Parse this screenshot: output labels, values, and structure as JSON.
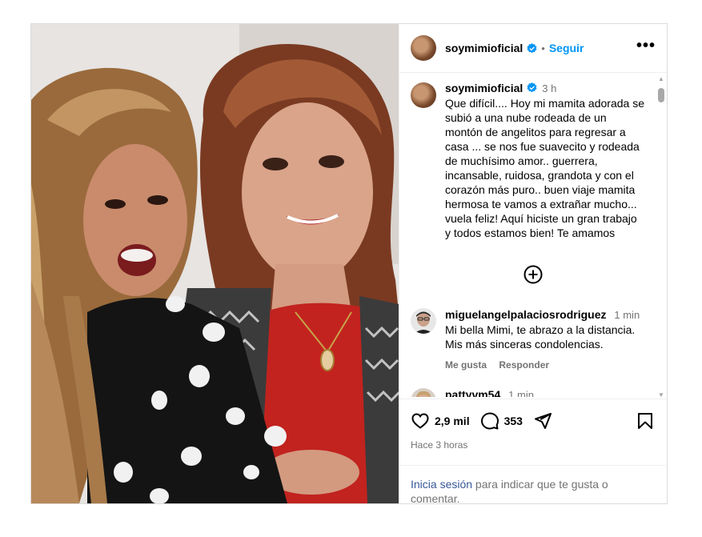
{
  "post": {
    "username": "soymimioficial",
    "follow_label": "Seguir",
    "separator": "•",
    "more_label": "•••",
    "caption_time": "3 h",
    "caption_text": "Que difícil.... Hoy mi mamita adorada se subió a una nube rodeada de un montón de angelitos para regresar a casa ... se nos fue suavecito y rodeada de muchísimo amor.. guerrera, incansable, ruidosa, grandota y con el corazón más puro.. buen viaje mamita hermosa te vamos a extrañar mucho... vuela feliz! Aquí hiciste un gran trabajo y todos estamos bien! Te amamos"
  },
  "comments": [
    {
      "username": "miguelangelpalaciosrodriguez",
      "time": "1 min",
      "text": "Mi bella Mimi, te abrazo a la distancia. Mis más sinceras condolencias.",
      "like_label": "Me gusta",
      "reply_label": "Responder"
    },
    {
      "username": "pattyvm54",
      "time": "1 min"
    }
  ],
  "footer": {
    "likes": "2,9 mil",
    "comments_count": "353",
    "posted_ago": "Hace 3 horas",
    "login_link": "Inicia sesión",
    "login_rest": " para indicar que te gusta o comentar."
  },
  "icons": {
    "header_avatar": "avatar-photo",
    "verified": "verified-badge-icon",
    "add_comment": "plus-circle-icon",
    "like": "heart-icon",
    "comment": "speech-bubble-icon",
    "share": "paper-plane-icon",
    "save": "bookmark-icon"
  },
  "colors": {
    "link_blue": "#0095f6",
    "muted": "#737373",
    "border": "#dbdbdb"
  }
}
